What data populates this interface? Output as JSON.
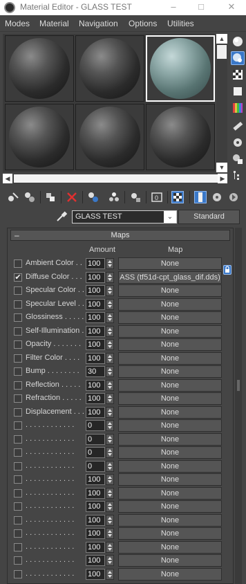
{
  "window": {
    "title": "Material Editor - GLASS TEST"
  },
  "menu": [
    "Modes",
    "Material",
    "Navigation",
    "Options",
    "Utilities"
  ],
  "material": {
    "name": "GLASS TEST",
    "type": "Standard"
  },
  "rollout": {
    "title": "Maps",
    "collapse_symbol": "–",
    "amount_header": "Amount",
    "map_header": "Map"
  },
  "maps": [
    {
      "label": "Ambient Color . .",
      "checked": "",
      "amount": "100",
      "map": "None"
    },
    {
      "label": "Diffuse Color . . .",
      "checked": "✔",
      "amount": "100",
      "map": "ASS (tf51d-cpt_glass_dif.dds)"
    },
    {
      "label": "Specular Color . .",
      "checked": "",
      "amount": "100",
      "map": "None"
    },
    {
      "label": "Specular Level  . .",
      "checked": "",
      "amount": "100",
      "map": "None"
    },
    {
      "label": "Glossiness  . . . . .",
      "checked": "",
      "amount": "100",
      "map": "None"
    },
    {
      "label": "Self-Illumination . .",
      "checked": "",
      "amount": "100",
      "map": "None"
    },
    {
      "label": "Opacity . . . . . . .",
      "checked": "",
      "amount": "100",
      "map": "None"
    },
    {
      "label": "Filter Color  . . . .",
      "checked": "",
      "amount": "100",
      "map": "None"
    },
    {
      "label": "Bump  . . . . . . . .",
      "checked": "",
      "amount": "30",
      "map": "None"
    },
    {
      "label": "Reflection  . . . . .",
      "checked": "",
      "amount": "100",
      "map": "None"
    },
    {
      "label": "Refraction  . . . . .",
      "checked": "",
      "amount": "100",
      "map": "None"
    },
    {
      "label": "Displacement  . . .",
      "checked": "",
      "amount": "100",
      "map": "None"
    },
    {
      "label": ". . . . . . . . . . . .",
      "checked": "",
      "amount": "0",
      "map": "None"
    },
    {
      "label": ". . . . . . . . . . . .",
      "checked": "",
      "amount": "0",
      "map": "None"
    },
    {
      "label": ". . . . . . . . . . . .",
      "checked": "",
      "amount": "0",
      "map": "None"
    },
    {
      "label": ". . . . . . . . . . . .",
      "checked": "",
      "amount": "0",
      "map": "None"
    },
    {
      "label": ". . . . . . . . . . . .",
      "checked": "",
      "amount": "100",
      "map": "None"
    },
    {
      "label": ". . . . . . . . . . . .",
      "checked": "",
      "amount": "100",
      "map": "None"
    },
    {
      "label": ". . . . . . . . . . . .",
      "checked": "",
      "amount": "100",
      "map": "None"
    },
    {
      "label": ". . . . . . . . . . . .",
      "checked": "",
      "amount": "100",
      "map": "None"
    },
    {
      "label": ". . . . . . . . . . . .",
      "checked": "",
      "amount": "100",
      "map": "None"
    },
    {
      "label": ". . . . . . . . . . . .",
      "checked": "",
      "amount": "100",
      "map": "None"
    },
    {
      "label": ". . . . . . . . . . . .",
      "checked": "",
      "amount": "100",
      "map": "None"
    },
    {
      "label": ". . . . . . . . . . . .",
      "checked": "",
      "amount": "100",
      "map": "None"
    }
  ],
  "colors": {
    "accent": "#3a78c8",
    "panel": "#444444",
    "field": "#262626"
  },
  "icons": {
    "slot_tools": [
      "get-material-icon",
      "put-to-scene-icon",
      "assign-to-selection-icon",
      "delete-icon",
      "make-copy-icon",
      "make-unique-icon",
      "put-to-library-icon",
      "material-id-icon",
      "show-map-icon",
      "show-shaded-icon",
      "show-end-result-icon",
      "go-to-parent-icon",
      "go-forward-icon"
    ],
    "side_tools": [
      "sample-type-icon",
      "backlight-icon",
      "background-icon",
      "sample-uv-tiling-icon",
      "video-color-check-icon",
      "make-preview-icon",
      "options-icon",
      "select-by-material-icon",
      "material-navigator-icon"
    ]
  }
}
